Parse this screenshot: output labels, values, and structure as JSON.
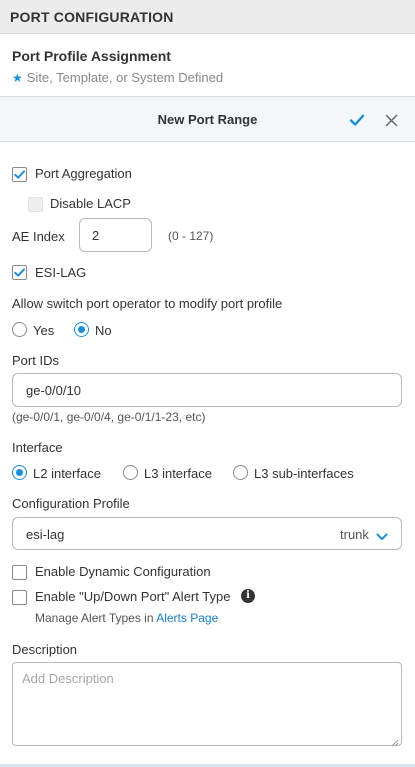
{
  "section": {
    "title": "PORT CONFIGURATION"
  },
  "profile": {
    "title": "Port Profile Assignment",
    "subtitle": "Site, Template, or System Defined",
    "subtitle_icon": "star-icon"
  },
  "range": {
    "title": "New Port Range",
    "confirm_icon": "check-icon",
    "close_icon": "close-icon"
  },
  "aggregation": {
    "label": "Port Aggregation",
    "checked": true
  },
  "lacp": {
    "label": "Disable LACP",
    "checked": false,
    "disabled": true
  },
  "ae_index": {
    "label": "AE Index",
    "value": "2",
    "range": "(0 - 127)"
  },
  "esi_lag": {
    "label": "ESI-LAG",
    "checked": true
  },
  "operator": {
    "label": "Allow switch port operator to modify port profile",
    "options": [
      "Yes",
      "No"
    ],
    "selected": "No"
  },
  "port_ids": {
    "label": "Port IDs",
    "value": "ge-0/0/10",
    "hint": "(ge-0/0/1, ge-0/0/4, ge-0/1/1-23, etc)"
  },
  "interface": {
    "label": "Interface",
    "options": [
      "L2 interface",
      "L3 interface",
      "L3 sub-interfaces"
    ],
    "selected": "L2 interface"
  },
  "config_profile": {
    "label": "Configuration Profile",
    "value": "esi-lag",
    "mode": "trunk"
  },
  "dynamic_config": {
    "label": "Enable Dynamic Configuration",
    "checked": false
  },
  "alert": {
    "label": "Enable \"Up/Down Port\" Alert Type",
    "checked": false,
    "manage_prefix": "Manage Alert Types in",
    "manage_link": "Alerts Page"
  },
  "description": {
    "label": "Description",
    "placeholder": "Add Description",
    "value": ""
  },
  "colors": {
    "accent": "#1a8fd6",
    "link": "#1a7ec4",
    "header_bg": "#ececec"
  }
}
